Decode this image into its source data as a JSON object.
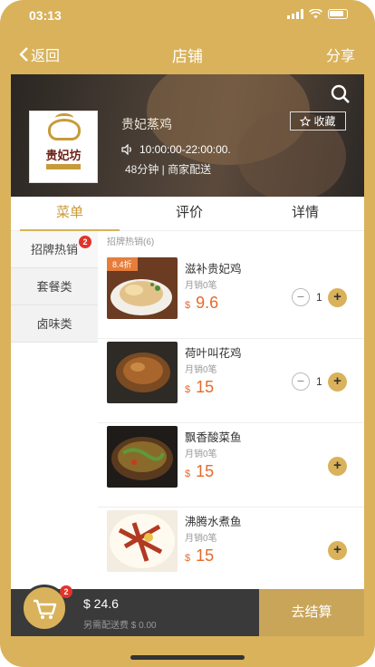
{
  "status_bar": {
    "time": "03:13"
  },
  "nav": {
    "back_label": "返回",
    "title": "店铺",
    "share_label": "分享"
  },
  "shop": {
    "logo_text": "贵妃坊",
    "name": "贵妃蒸鸡",
    "hours": "10:00:00-22:00:00.",
    "delivery_meta": "48分钟 | 商家配送",
    "favorite_label": "收藏"
  },
  "tabs": [
    {
      "label": "菜单",
      "active": true
    },
    {
      "label": "评价",
      "active": false
    },
    {
      "label": "详情",
      "active": false
    }
  ],
  "categories": [
    {
      "label": "招牌热销",
      "badge": "2",
      "active": true
    },
    {
      "label": "套餐类",
      "active": false
    },
    {
      "label": "卤味类",
      "active": false
    }
  ],
  "section_label": "招牌热销(6)",
  "items": [
    {
      "name": "滋补贵妃鸡",
      "sales": "月销0笔",
      "currency": "$",
      "price": "9.6",
      "discount": "8.4折",
      "qty": "1"
    },
    {
      "name": "荷叶叫花鸡",
      "sales": "月销0笔",
      "currency": "$",
      "price": "15",
      "qty": "1"
    },
    {
      "name": "飘香酸菜鱼",
      "sales": "月销0笔",
      "currency": "$",
      "price": "15"
    },
    {
      "name": "沸腾水煮鱼",
      "sales": "月销0笔",
      "currency": "$",
      "price": "15"
    }
  ],
  "cart": {
    "badge": "2",
    "total": "$ 24.6",
    "shipping": "另需配送费 $ 0.00",
    "checkout_label": "去结算"
  },
  "colors": {
    "accent": "#d9b25b",
    "price": "#e56a2b",
    "badge": "#e0342b",
    "cart_bar": "#3a3a3a"
  }
}
